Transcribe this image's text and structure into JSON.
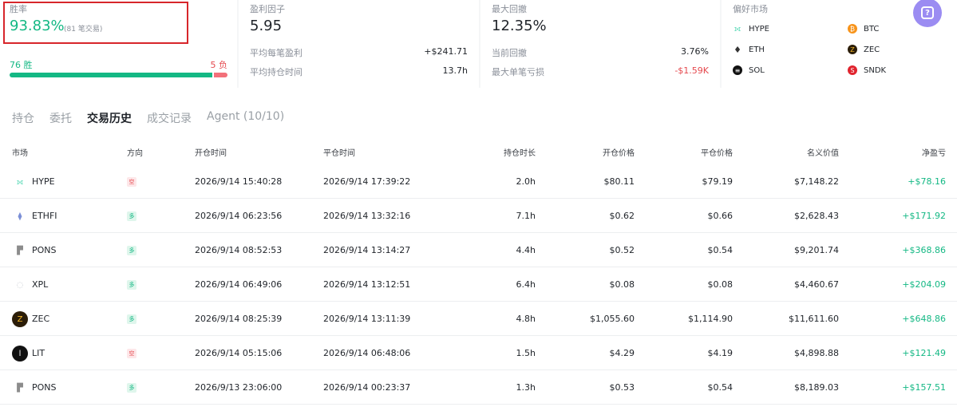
{
  "stats": {
    "winrate": {
      "label": "胜率",
      "value": "93.83%",
      "sub": "(81 笔交易)",
      "wins": "76 胜",
      "losses": "5 负",
      "win_fraction": 0.938
    },
    "profit_factor": {
      "label": "盈利因子",
      "value": "5.95",
      "rows": [
        {
          "label": "平均每笔盈利",
          "value": "+$241.71"
        },
        {
          "label": "平均持仓时间",
          "value": "13.7h"
        }
      ]
    },
    "drawdown": {
      "label": "最大回撤",
      "value": "12.35%",
      "rows": [
        {
          "label": "当前回撤",
          "value": "3.76%"
        },
        {
          "label": "最大单笔亏损",
          "value": "-$1.59K"
        }
      ]
    },
    "preferred": {
      "label": "偏好市场",
      "markets": [
        "HYPE",
        "BTC",
        "ETH",
        "ZEC",
        "SOL",
        "SNDK"
      ]
    }
  },
  "tabs": [
    "持仓",
    "委托",
    "交易历史",
    "成交记录",
    "Agent (10/10)"
  ],
  "active_tab": 2,
  "table": {
    "headers": [
      "市场",
      "方向",
      "开仓时间",
      "平仓时间",
      "持仓时长",
      "开仓价格",
      "平仓价格",
      "名义价值",
      "净盈亏"
    ],
    "rows": [
      {
        "market": "HYPE",
        "side": "空",
        "open": "2026/9/14 15:40:28",
        "close": "2026/9/14 17:39:22",
        "dur": "2.0h",
        "op": "$80.11",
        "cp": "$79.19",
        "notional": "$7,148.22",
        "pnl": "+$78.16"
      },
      {
        "market": "ETHFI",
        "side": "多",
        "open": "2026/9/14 06:23:56",
        "close": "2026/9/14 13:32:16",
        "dur": "7.1h",
        "op": "$0.62",
        "cp": "$0.66",
        "notional": "$2,628.43",
        "pnl": "+$171.92"
      },
      {
        "market": "PONS",
        "side": "多",
        "open": "2026/9/14 08:52:53",
        "close": "2026/9/14 13:14:27",
        "dur": "4.4h",
        "op": "$0.52",
        "cp": "$0.54",
        "notional": "$9,201.74",
        "pnl": "+$368.86"
      },
      {
        "market": "XPL",
        "side": "多",
        "open": "2026/9/14 06:49:06",
        "close": "2026/9/14 13:12:51",
        "dur": "6.4h",
        "op": "$0.08",
        "cp": "$0.08",
        "notional": "$4,460.67",
        "pnl": "+$204.09"
      },
      {
        "market": "ZEC",
        "side": "多",
        "open": "2026/9/14 08:25:39",
        "close": "2026/9/14 13:11:39",
        "dur": "4.8h",
        "op": "$1,055.60",
        "cp": "$1,114.90",
        "notional": "$11,611.60",
        "pnl": "+$648.86"
      },
      {
        "market": "LIT",
        "side": "空",
        "open": "2026/9/14 05:15:06",
        "close": "2026/9/14 06:48:06",
        "dur": "1.5h",
        "op": "$4.29",
        "cp": "$4.19",
        "notional": "$4,898.88",
        "pnl": "+$121.49"
      },
      {
        "market": "PONS",
        "side": "多",
        "open": "2026/9/13 23:06:00",
        "close": "2026/9/14 00:23:37",
        "dur": "1.3h",
        "op": "$0.53",
        "cp": "$0.54",
        "notional": "$8,189.03",
        "pnl": "+$157.51"
      }
    ]
  },
  "colors": {
    "green": "#14b884",
    "red": "#e5484d",
    "accent": "#9b8cf2"
  }
}
